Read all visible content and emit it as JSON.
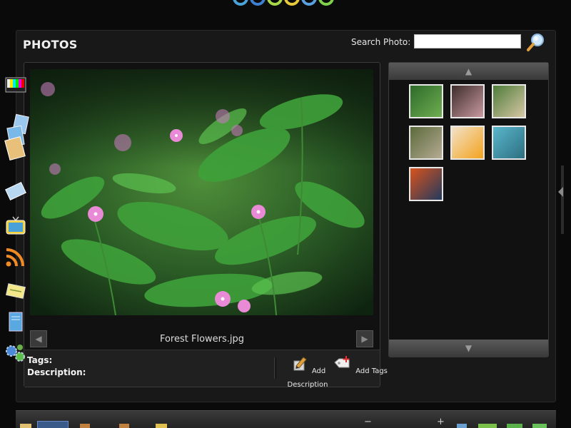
{
  "logo": {
    "ring_colors": [
      "#4aa3d8",
      "#3f7fd0",
      "#a6d84a",
      "#e8c93a",
      "#5aa0e0",
      "#7fd04a"
    ]
  },
  "header": {
    "title": "PHOTOS",
    "search_label": "Search Photo:",
    "search_value": "",
    "search_placeholder": ""
  },
  "viewer": {
    "filename": "Forest Flowers.jpg",
    "tags_label": "Tags:",
    "description_label": "Description:",
    "actions": {
      "add_description": "Add Description",
      "add_tags": "Add Tags"
    }
  },
  "thumbnails": [
    {
      "name": "green-fern-thumb",
      "colors": [
        "#2e6a2a",
        "#6fae52"
      ]
    },
    {
      "name": "pink-blossom-thumb",
      "colors": [
        "#3d2c2a",
        "#c99aa0"
      ]
    },
    {
      "name": "garden-house-thumb",
      "colors": [
        "#4e7c3a",
        "#d7c7a4"
      ]
    },
    {
      "name": "rock-garden-thumb",
      "colors": [
        "#5b6a3a",
        "#b5ab94"
      ]
    },
    {
      "name": "tulips-thumb",
      "colors": [
        "#f2e2c8",
        "#f3a31e"
      ]
    },
    {
      "name": "sea-turtle-thumb",
      "colors": [
        "#5ab6cc",
        "#2d6f80"
      ]
    },
    {
      "name": "sunset-lake-thumb",
      "colors": [
        "#d9531c",
        "#223a5e"
      ]
    }
  ],
  "colors": {
    "panel_bg": "#181818",
    "accent": "#e8e8e8"
  },
  "bottom_bar": {
    "minus": "−",
    "plus": "+"
  }
}
